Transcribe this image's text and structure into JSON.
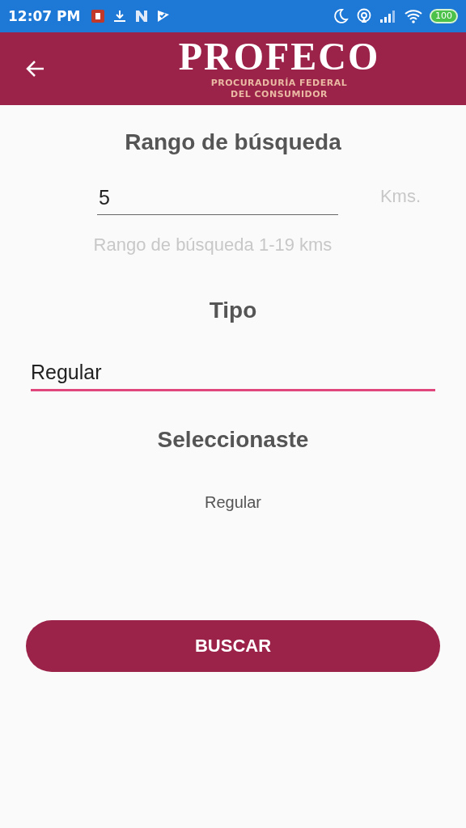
{
  "status_bar": {
    "time": "12:07 PM",
    "battery": "100"
  },
  "app_bar": {
    "logo_title": "PROFECO",
    "logo_subtitle_1": "PROCURADURÍA FEDERAL",
    "logo_subtitle_2": "DEL CONSUMIDOR"
  },
  "range": {
    "heading": "Rango de búsqueda",
    "value": "5",
    "unit": "Kms.",
    "hint": "Rango de búsqueda 1-19 kms",
    "focused": false
  },
  "type": {
    "heading": "Tipo",
    "value": "Regular",
    "focused": true
  },
  "selection": {
    "heading": "Seleccionaste",
    "value": "Regular"
  },
  "button": {
    "label": "BUSCAR"
  }
}
